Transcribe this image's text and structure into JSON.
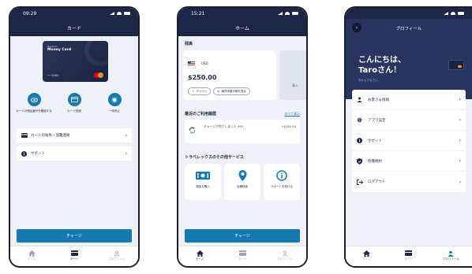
{
  "phone1": {
    "status_time": "09:29",
    "title": "カード",
    "card": {
      "brand": "Travelex",
      "name": "Money Card",
      "number": "•• 5063"
    },
    "actions": [
      {
        "label": "カードの暗証番号を確認する",
        "icon": "eye-icon"
      },
      {
        "label": "カード詳細",
        "icon": "card-icon"
      },
      {
        "label": "一時停止",
        "icon": "snowflake-icon"
      }
    ],
    "list": [
      {
        "label": "カードの紛失・盗難連絡",
        "icon": "card-icon"
      },
      {
        "label": "サポート",
        "icon": "info-icon"
      }
    ],
    "cta": "チャージ",
    "nav": [
      "ホーム",
      "カード",
      "プロフィール"
    ]
  },
  "phone2": {
    "status_time": "15:21",
    "title": "ホーム",
    "balance_section": "残高",
    "currency": "USD",
    "amount": "$250.00",
    "charge_pill": "チャージ",
    "convert_pill": "通貨両替手順を見る",
    "ghost_label": "高レ",
    "recent_title": "最近のご利用履歴",
    "see_all": "すべて表示",
    "tx_desc": "チャージが完了しました ※5*",
    "tx_amount": "+$250.00",
    "services_title": "トラベレックスのその他サービス",
    "services": [
      {
        "label": "現金を購入",
        "icon": "money-icon"
      },
      {
        "label": "店舗検索",
        "icon": "location-pin-icon"
      },
      {
        "label": "サポートを受ける",
        "icon": "info-icon"
      }
    ],
    "cta": "チャージ",
    "nav": [
      "ホーム",
      "カード",
      "プロフィール"
    ]
  },
  "phone3": {
    "title": "プロフィール",
    "greeting_line1": "こんにちは、",
    "greeting_line2": "Taroさん！",
    "greeting_sub": "おかえりなさい。",
    "list": [
      {
        "label": "お客さま情報",
        "icon": "person-icon"
      },
      {
        "label": "アプリ設定",
        "icon": "gear-icon"
      },
      {
        "label": "サポート",
        "icon": "info-icon"
      },
      {
        "label": "各種規約",
        "icon": "shield-icon"
      },
      {
        "label": "ログアウト",
        "icon": "logout-icon"
      }
    ],
    "nav": [
      "ホーム",
      "カード",
      "プロフィール"
    ]
  },
  "colors": {
    "navy": "#1d2647",
    "accent": "#1679b0",
    "background": "#eef1f5"
  }
}
